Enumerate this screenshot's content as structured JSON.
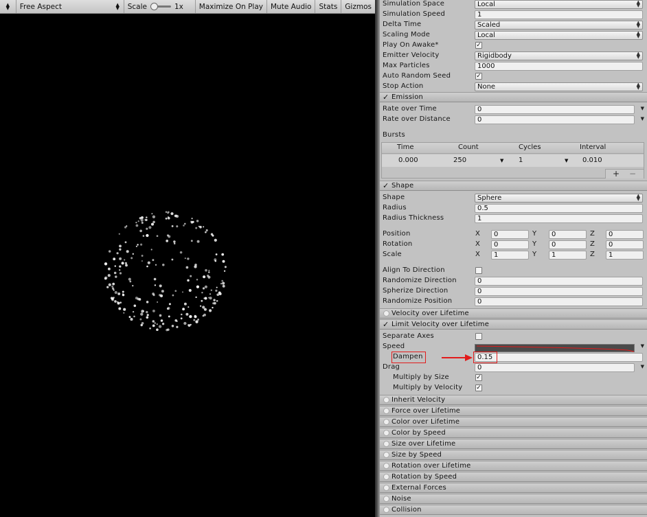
{
  "game_view": {
    "toolbar": {
      "aspect": "Free Aspect",
      "scale_label": "Scale",
      "scale_value": "1x",
      "maximize": "Maximize On Play",
      "mute": "Mute Audio",
      "stats": "Stats",
      "gizmos": "Gizmos"
    }
  },
  "inspector": {
    "main": [
      {
        "label": "Simulation Space",
        "value": "Local",
        "kind": "dropdown"
      },
      {
        "label": "Simulation Speed",
        "value": "1",
        "kind": "field"
      },
      {
        "label": "Delta Time",
        "value": "Scaled",
        "kind": "dropdown"
      },
      {
        "label": "Scaling Mode",
        "value": "Local",
        "kind": "dropdown"
      },
      {
        "label": "Play On Awake*",
        "value": "✓",
        "kind": "check"
      },
      {
        "label": "Emitter Velocity",
        "value": "Rigidbody",
        "kind": "dropdown"
      },
      {
        "label": "Max Particles",
        "value": "1000",
        "kind": "field"
      },
      {
        "label": "Auto Random Seed",
        "value": "✓",
        "kind": "check"
      },
      {
        "label": "Stop Action",
        "value": "None",
        "kind": "dropdown"
      }
    ],
    "emission": {
      "title": "Emission",
      "rate_over_time_label": "Rate over Time",
      "rate_over_time": "0",
      "rate_over_distance_label": "Rate over Distance",
      "rate_over_distance": "0",
      "bursts_label": "Bursts",
      "bursts_headers": [
        "Time",
        "Count",
        "Cycles",
        "Interval"
      ],
      "bursts_row": {
        "time": "0.000",
        "count": "250",
        "cycles": "1",
        "interval": "0.010"
      },
      "add": "+",
      "remove": "−"
    },
    "shape": {
      "title": "Shape",
      "shape_label": "Shape",
      "shape_value": "Sphere",
      "radius_label": "Radius",
      "radius": "0.5",
      "radius_thickness_label": "Radius Thickness",
      "radius_thickness": "1",
      "axis_x": "X",
      "axis_y": "Y",
      "axis_z": "Z",
      "position_label": "Position",
      "position": [
        "0",
        "0",
        "0"
      ],
      "rotation_label": "Rotation",
      "rotation": [
        "0",
        "0",
        "0"
      ],
      "scale_label": "Scale",
      "scale": [
        "1",
        "1",
        "1"
      ],
      "align_label": "Align To Direction",
      "randomize_dir_label": "Randomize Direction",
      "randomize_dir": "0",
      "spherize_label": "Spherize Direction",
      "spherize": "0",
      "randomize_pos_label": "Randomize Position",
      "randomize_pos": "0"
    },
    "velocity_over_lifetime": "Velocity over Lifetime",
    "limit_velocity": {
      "title": "Limit Velocity over Lifetime",
      "separate_axes_label": "Separate Axes",
      "speed_label": "Speed",
      "dampen_label": "Dampen",
      "dampen": "0.15",
      "drag_label": "Drag",
      "drag": "0",
      "mult_size_label": "Multiply by Size",
      "mult_size": "✓",
      "mult_vel_label": "Multiply by Velocity",
      "mult_vel": "✓"
    },
    "modules": [
      "Inherit Velocity",
      "Force over Lifetime",
      "Color over Lifetime",
      "Color by Speed",
      "Size over Lifetime",
      "Size by Speed",
      "Rotation over Lifetime",
      "Rotation by Speed",
      "External Forces",
      "Noise",
      "Collision"
    ]
  },
  "colors": {
    "annotation_red": "#e21b1b",
    "inspector_bg": "#c2c2c2",
    "particle": "#f2f2f2"
  }
}
